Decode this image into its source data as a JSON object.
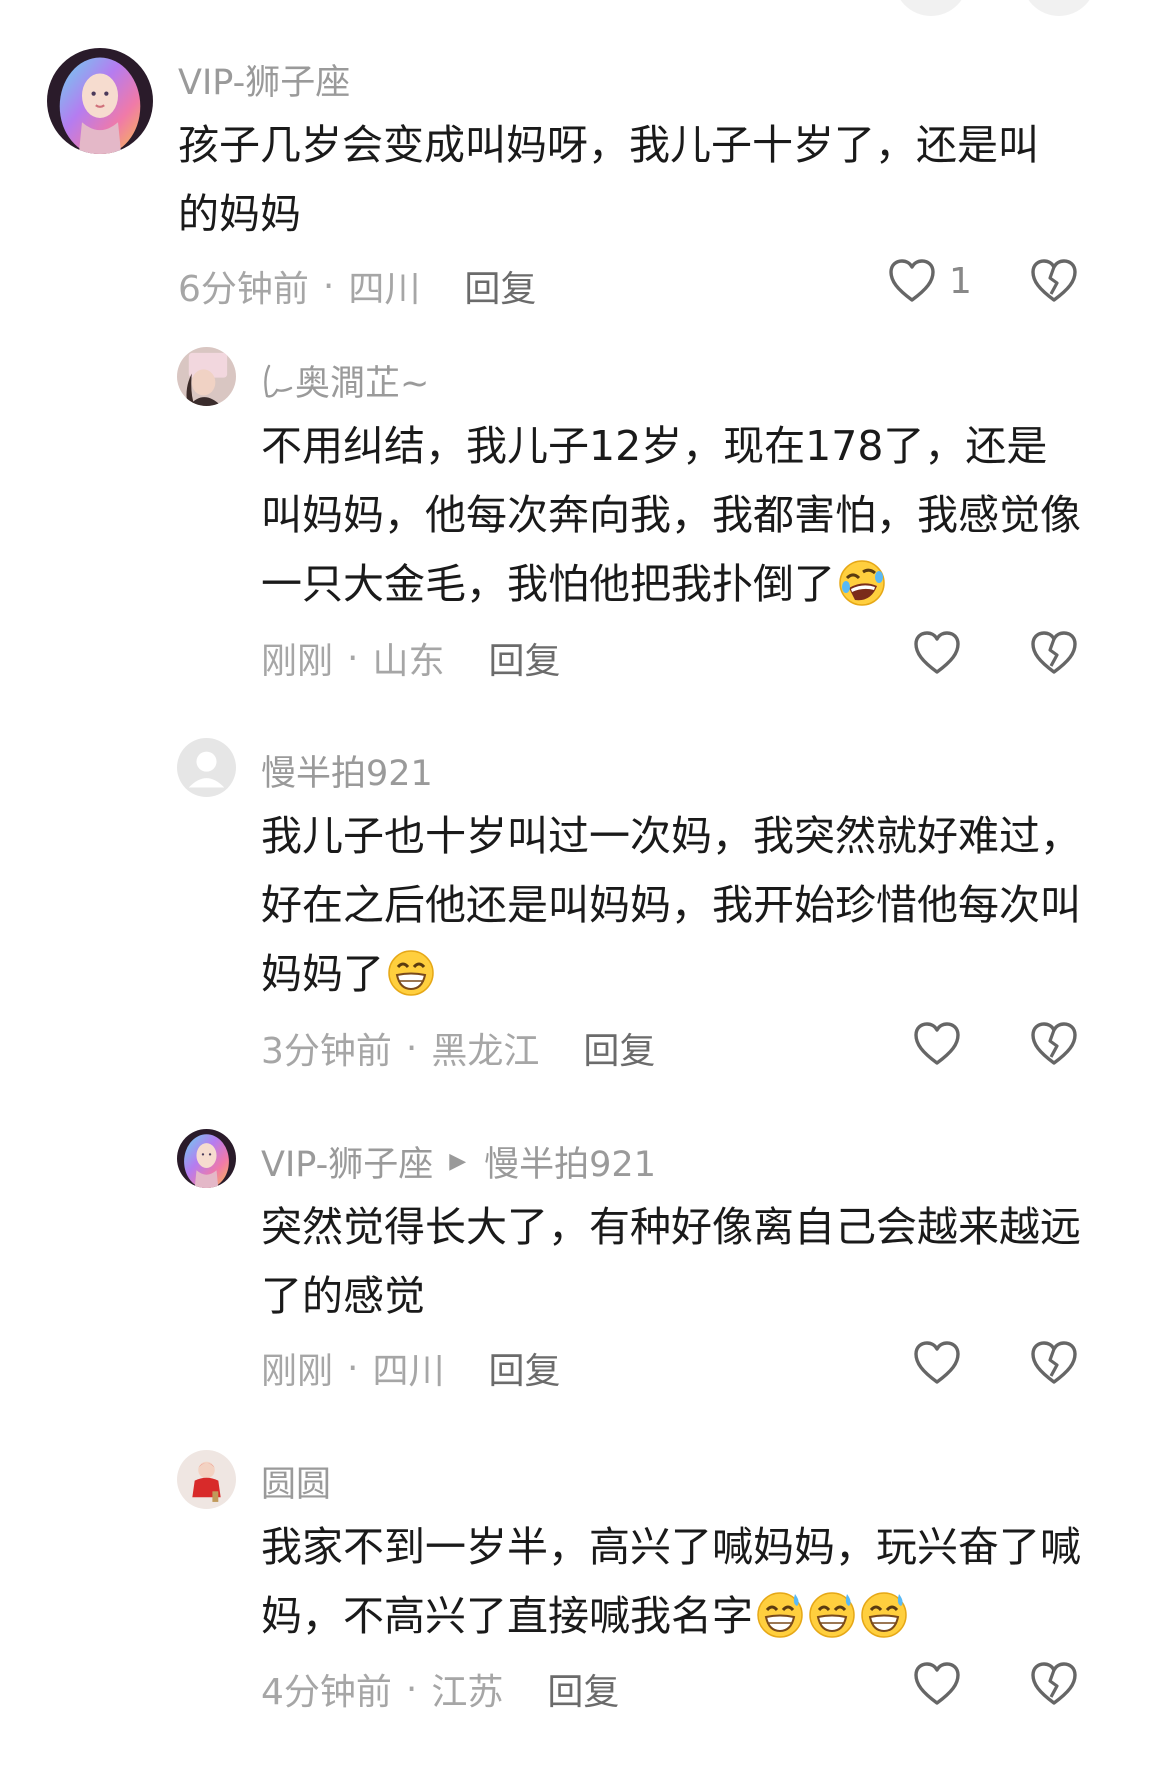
{
  "comments": [
    {
      "username": "VIP-狮子座",
      "text": "孩子几岁会变成叫妈呀，我儿子十岁了，还是叫的妈妈",
      "time": "6分钟前",
      "location": "四川",
      "reply_label": "回复",
      "like_count": "1",
      "avatar": "colorful-hair-girl",
      "level": "top"
    },
    {
      "username": "奥澗芷~",
      "text": "不用纠结，我儿子12岁，现在178了，还是叫妈妈，他每次奔向我，我都害怕，我感觉像一只大金毛，我怕他把我扑倒了",
      "emoji": [
        "rolling-laugh-emoji"
      ],
      "time": "刚刚",
      "location": "山东",
      "reply_label": "回复",
      "like_count": "",
      "avatar": "woman-photo",
      "level": "reply"
    },
    {
      "username": "慢半拍921",
      "text": "我儿子也十岁叫过一次妈，我突然就好难过，好在之后他还是叫妈妈，我开始珍惜他每次叫妈妈了",
      "emoji": [
        "grin-emoji"
      ],
      "time": "3分钟前",
      "location": "黑龙江",
      "reply_label": "回复",
      "like_count": "",
      "avatar": "default-person",
      "level": "reply"
    },
    {
      "username": "VIP-狮子座",
      "reply_to": "慢半拍921",
      "text": "突然觉得长大了，有种好像离自己会越来越远了的感觉",
      "time": "刚刚",
      "location": "四川",
      "reply_label": "回复",
      "like_count": "",
      "avatar": "colorful-hair-girl",
      "level": "reply"
    },
    {
      "username": "圆圆",
      "text": "我家不到一岁半，高兴了喊妈妈，玩兴奋了喊妈，不高兴了直接喊我名字",
      "emoji": [
        "sweat-grin-emoji",
        "sweat-grin-emoji",
        "sweat-grin-emoji"
      ],
      "time": "4分钟前",
      "location": "江苏",
      "reply_label": "回复",
      "like_count": "",
      "avatar": "baby-in-red",
      "level": "reply"
    }
  ],
  "colors": {
    "name": "#9a9a9a",
    "text": "#1a1a1a",
    "meta": "#a6a6a6",
    "reply": "#6b6b6b",
    "icon": "#666666"
  }
}
